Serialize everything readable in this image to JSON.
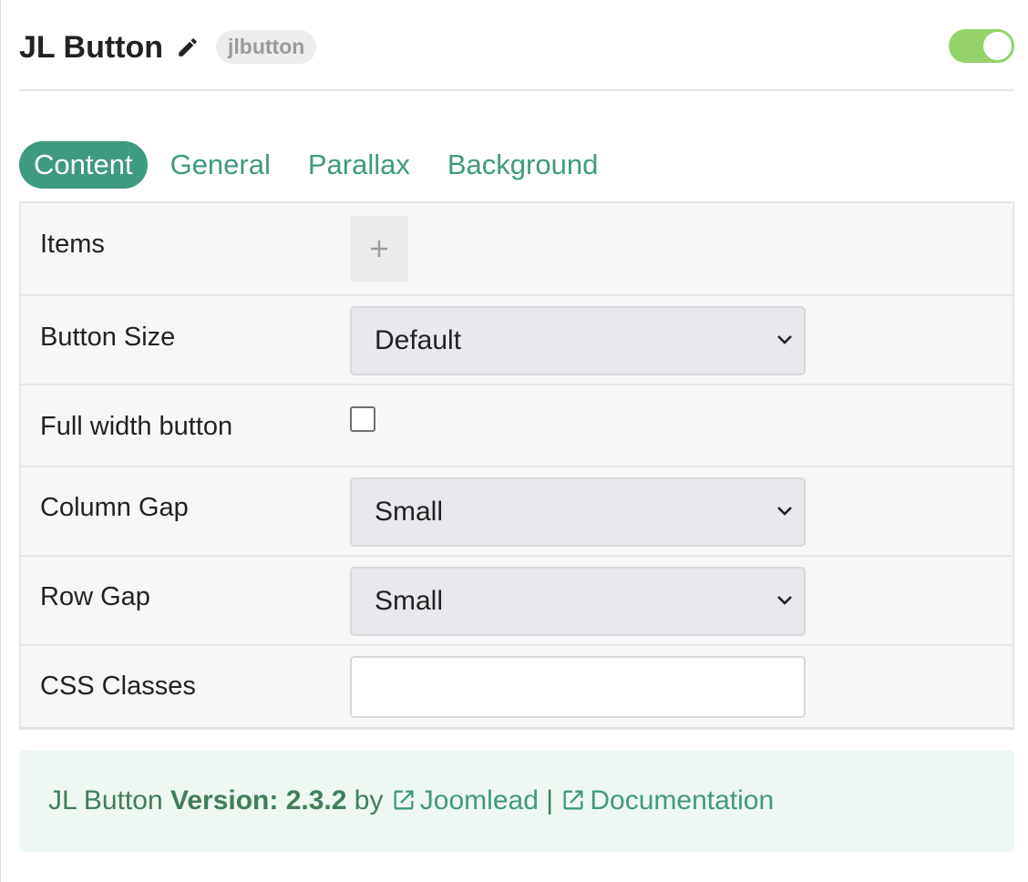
{
  "header": {
    "title": "JL Button",
    "badge": "jlbutton",
    "enabled": true
  },
  "tabs": [
    {
      "label": "Content",
      "active": true
    },
    {
      "label": "General",
      "active": false
    },
    {
      "label": "Parallax",
      "active": false
    },
    {
      "label": "Background",
      "active": false
    }
  ],
  "fields": {
    "items": {
      "label": "Items",
      "add_icon": "plus-icon"
    },
    "button_size": {
      "label": "Button Size",
      "value": "Default"
    },
    "full_width": {
      "label": "Full width button",
      "checked": false
    },
    "column_gap": {
      "label": "Column Gap",
      "value": "Small"
    },
    "row_gap": {
      "label": "Row Gap",
      "value": "Small"
    },
    "css_classes": {
      "label": "CSS Classes",
      "value": "",
      "placeholder": ""
    }
  },
  "footer": {
    "name": "JL Button",
    "version_label": "Version: 2.3.2",
    "by": "by",
    "link1": "Joomlead",
    "separator": "|",
    "link2": "Documentation",
    "link_icon": "external-link-icon"
  },
  "colors": {
    "accent": "#3e9a80",
    "toggle_on": "#93d36a",
    "footer_bg": "#eff7f2",
    "footer_text": "#3f7e58"
  }
}
